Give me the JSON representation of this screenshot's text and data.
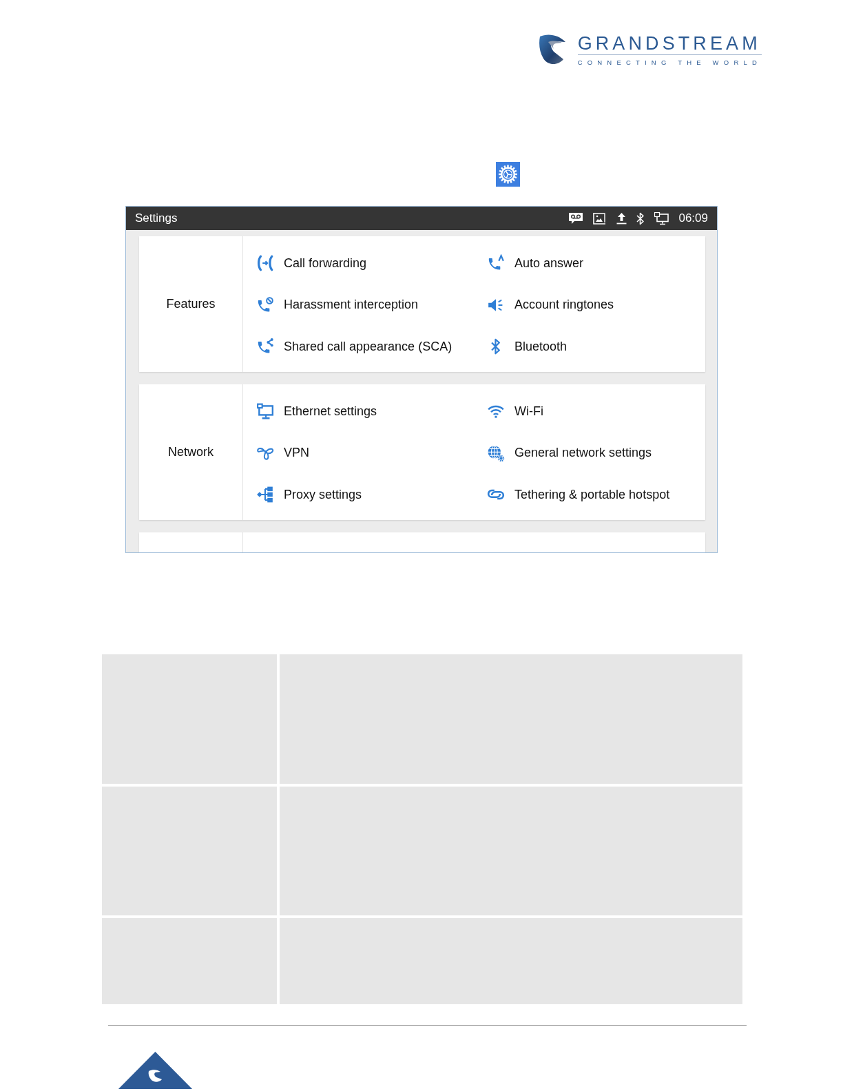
{
  "header": {
    "brand_name": "GRANDSTREAM",
    "brand_tagline": "CONNECTING THE WORLD"
  },
  "settings_window": {
    "title": "Settings",
    "status_time": "06:09",
    "sections": [
      {
        "label": "Features",
        "items": [
          "Call forwarding",
          "Auto answer",
          "Harassment interception",
          "Account ringtones",
          "Shared call appearance (SCA)",
          "Bluetooth"
        ]
      },
      {
        "label": "Network",
        "items": [
          "Ethernet settings",
          "Wi-Fi",
          "VPN",
          "General network settings",
          "Proxy settings",
          "Tethering & portable hotspot"
        ]
      }
    ]
  }
}
